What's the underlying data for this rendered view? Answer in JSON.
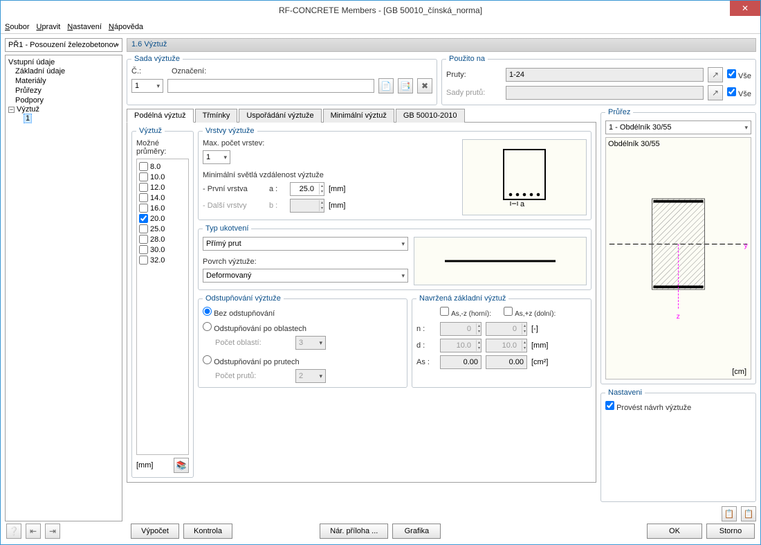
{
  "window": {
    "title": "RF-CONCRETE Members - [GB 50010_čínská_norma]"
  },
  "menu": {
    "file": "Soubor",
    "edit": "Upravit",
    "settings": "Nastavení",
    "help": "Nápověda"
  },
  "case_selector": "PŘ1 - Posouzení železobetonov",
  "page_title": "1.6 Výztuž",
  "tree": {
    "root": "Vstupní údaje",
    "n1": "Základní údaje",
    "n2": "Materiály",
    "n3": "Průřezy",
    "n4": "Podpory",
    "n5": "Výztuž",
    "n5a": "1"
  },
  "set": {
    "legend": "Sada výztuže",
    "no_label": "Č.:",
    "no_value": "1",
    "desc_label": "Označení:",
    "desc_value": ""
  },
  "used": {
    "legend": "Použito na",
    "members_label": "Pruty:",
    "members_value": "1-24",
    "sets_label": "Sady prutů:",
    "sets_value": "",
    "all": "Vše"
  },
  "tabs": {
    "t1": "Podélná výztuž",
    "t2": "Třmínky",
    "t3": "Uspořádání výztuže",
    "t4": "Minimální výztuž",
    "t5": "GB 50010-2010"
  },
  "reinf": {
    "legend": "Výztuž",
    "possible": "Možné průměry:",
    "d": [
      "8.0",
      "10.0",
      "12.0",
      "14.0",
      "16.0",
      "20.0",
      "25.0",
      "28.0",
      "30.0",
      "32.0"
    ],
    "checked_index": 5,
    "unit": "[mm]"
  },
  "layers": {
    "legend": "Vrstvy výztuže",
    "max_label": "Max. počet vrstev:",
    "max_value": "1",
    "min_dist": "Minimální světlá vzdálenost výztuže",
    "first": "- První vrstva",
    "a": "a :",
    "a_val": "25.0",
    "others": "- Další vrstvy",
    "b": "b :",
    "b_val": "",
    "mm": "[mm]"
  },
  "anchor": {
    "legend": "Typ ukotvení",
    "type_value": "Přímý prut",
    "surface_label": "Povrch výztuže:",
    "surface_value": "Deformovaný"
  },
  "curt": {
    "legend": "Odstupňování výztuže",
    "r1": "Bez odstupňování",
    "r2": "Odstupňování po oblastech",
    "r2a": "Počet oblastí:",
    "r2v": "3",
    "r3": "Odstupňování po prutech",
    "r3a": "Počet prutů:",
    "r3v": "2"
  },
  "provided": {
    "legend": "Navržená základní výztuž",
    "top": "As,-z (horní):",
    "bot": "As,+z (dolní):",
    "n": "n :",
    "d": "d :",
    "as": "As :",
    "nv1": "0",
    "nv2": "0",
    "dv1": "10.0",
    "dv2": "10.0",
    "av1": "0.00",
    "av2": "0.00",
    "u_count": "[-]",
    "u_mm": "[mm]",
    "u_cm2": "[cm²]"
  },
  "section": {
    "legend": "Průřez",
    "combo": "1 - Obdélník 30/55",
    "name": "Obdélník 30/55",
    "unit": "[cm]"
  },
  "settings": {
    "legend": "Nastaveni",
    "chk": "Provést návrh výztuže"
  },
  "footer": {
    "calc": "Výpočet",
    "check": "Kontrola",
    "annex": "Nár. příloha ...",
    "graphics": "Grafika",
    "ok": "OK",
    "cancel": "Storno"
  }
}
